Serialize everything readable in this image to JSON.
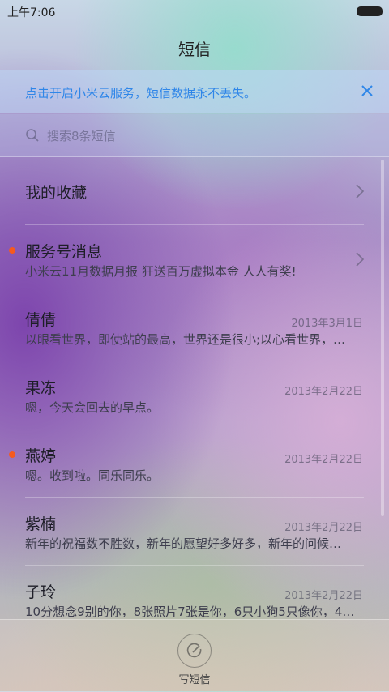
{
  "status_bar": {
    "time": "上午7:06"
  },
  "header": {
    "title": "短信"
  },
  "banner": {
    "text": "点击开启小米云服务，短信数据永不丢失。",
    "accent": "#2f86e8"
  },
  "search": {
    "placeholder": "搜索8条短信"
  },
  "conversations": [
    {
      "title": "我的收藏",
      "snippet": "",
      "date": "",
      "unread": false,
      "chevron": true
    },
    {
      "title": "服务号消息",
      "snippet": "小米云11月数据月报 狂送百万虚拟本金 人人有奖!",
      "date": "",
      "unread": true,
      "chevron": true
    },
    {
      "title": "倩倩",
      "snippet": "以眼看世界，即使站的最高，世界还是很小;以心看世界，…",
      "date": "2013年3月1日",
      "unread": false,
      "chevron": false
    },
    {
      "title": "果冻",
      "snippet": "嗯，今天会回去的早点。",
      "date": "2013年2月22日",
      "unread": false,
      "chevron": false
    },
    {
      "title": "燕婷",
      "snippet": "嗯。收到啦。同乐同乐。",
      "date": "2013年2月22日",
      "unread": true,
      "chevron": false
    },
    {
      "title": "紫楠",
      "snippet": "新年的祝福数不胜数，新年的愿望好多好多，新年的问候…",
      "date": "2013年2月22日",
      "unread": false,
      "chevron": false
    },
    {
      "title": "子玲",
      "snippet": "10分想念9别的你，8张照片7张是你，6只小狗5只像你，4…",
      "date": "2013年2月22日",
      "unread": false,
      "chevron": false
    }
  ],
  "bottom_bar": {
    "compose_label": "写短信"
  },
  "colors": {
    "unread_dot": "#f55a1e"
  }
}
